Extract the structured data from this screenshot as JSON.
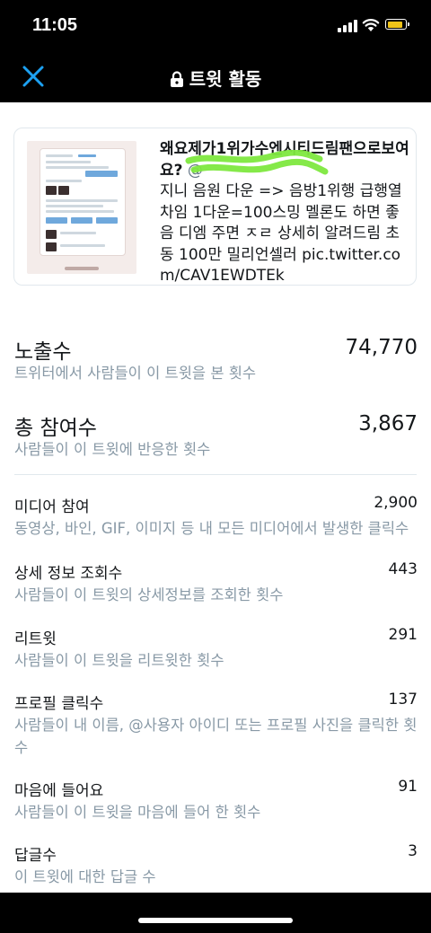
{
  "status_bar": {
    "time": "11:05",
    "battery_level": 0.85,
    "battery_color": "#f0c419"
  },
  "header": {
    "title": "트윗 활동",
    "close_icon": "close-icon",
    "lock_icon": "lock-icon",
    "accent_color": "#1da1f2"
  },
  "tweet": {
    "author": "왜요제가1위가수엔시티드림팬으로보여요?",
    "handle": "@",
    "text": "지니 음원 다운 => 음방1위행 급행열차임 1다운=100스밍 멜론도 하면 좋음 디엠 주면 ㅈㄹ 상세히 알려드림 초동 100만 밀리언셀러 pic.twitter.com/CAV1EWDTEk",
    "redaction_color": "#7ee83f"
  },
  "metrics": {
    "impressions": {
      "label": "노출수",
      "value": "74,770",
      "desc": "트위터에서 사람들이 이 트윗을 본 횟수"
    },
    "engagements": {
      "label": "총 참여수",
      "value": "3,867",
      "desc": "사람들이 이 트윗에 반응한 횟수"
    },
    "media": {
      "label": "미디어 참여",
      "value": "2,900",
      "desc": "동영상, 바인, GIF, 이미지 등 내 모든 미디어에서 발생한 클릭수"
    },
    "detail": {
      "label": "상세 정보 조회수",
      "value": "443",
      "desc": "사람들이 이 트윗의 상세정보를 조회한 횟수"
    },
    "retweets": {
      "label": "리트윗",
      "value": "291",
      "desc": "사람들이 이 트윗을 리트윗한 횟수"
    },
    "profile": {
      "label": "프로필 클릭수",
      "value": "137",
      "desc": "사람들이 내 이름, @사용자 아이디 또는 프로필 사진을 클릭한 횟수"
    },
    "likes": {
      "label": "마음에 들어요",
      "value": "91",
      "desc": "사람들이 이 트윗을 마음에 들어 한 횟수"
    },
    "replies": {
      "label": "답글수",
      "value": "3",
      "desc": "이 트윗에 대한 답글 수"
    }
  }
}
